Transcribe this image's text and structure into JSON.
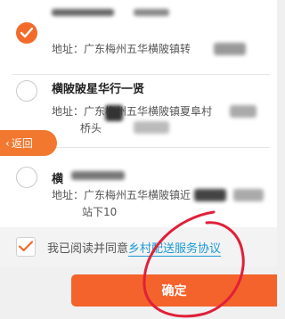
{
  "addresses": [
    {
      "name": "",
      "address_line1": "地址：广东梅州五华横陂镇转",
      "address_line2": "",
      "selected": true
    },
    {
      "name": "横陂陂星华行一贤",
      "address_line1": "地址：广东梅州五华横陂镇夏阜村",
      "address_line2": "桥头",
      "selected": false
    },
    {
      "name": "横",
      "address_line1": "地址：广东梅州五华横陂镇近",
      "address_line2": "站下10",
      "selected": false
    }
  ],
  "back_label": "返回",
  "agreement": {
    "prefix": "我已阅读并同意",
    "link_text": "乡村配送服务协议",
    "checked": true
  },
  "confirm_label": "确定",
  "colors": {
    "accent": "#f26b2a",
    "link": "#1a9ad6",
    "annotation": "#e0203a"
  }
}
